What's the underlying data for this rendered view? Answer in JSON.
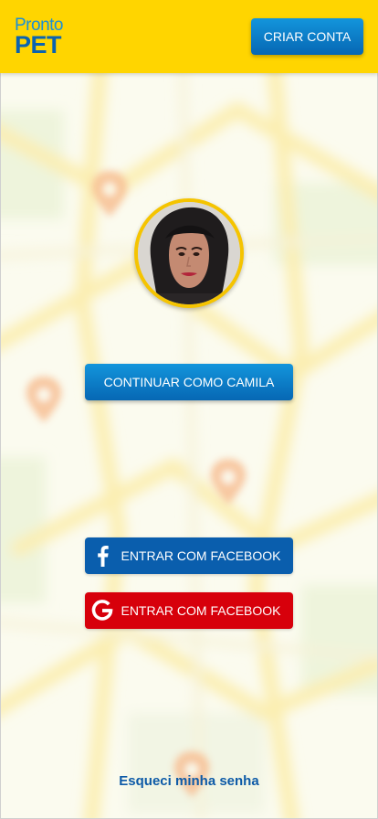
{
  "header": {
    "logo_top": "Pronto",
    "logo_bottom": "PET",
    "create_account_label": "CRIAR CONTA"
  },
  "profile": {
    "continue_label": "CONTINUAR COMO CAMILA"
  },
  "social": {
    "facebook_label": "ENTRAR COM FACEBOOK",
    "google_label": "ENTRAR COM FACEBOOK"
  },
  "forgot_password": "Esqueci minha senha",
  "colors": {
    "header_bg": "#ffd500",
    "primary_blue": "#0a63b0",
    "facebook_blue": "#0a5ead",
    "google_red": "#d7000b",
    "avatar_ring": "#f5c400"
  },
  "icons": {
    "facebook": "facebook-icon",
    "google": "google-icon",
    "map_pins": "map-pin-icon"
  }
}
